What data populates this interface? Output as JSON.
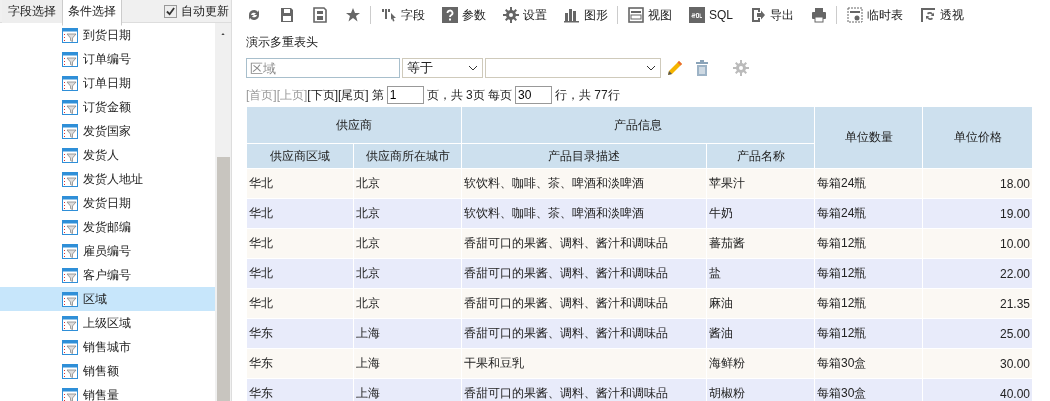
{
  "sidebar": {
    "tabs": [
      {
        "label": "字段选择",
        "selected": false
      },
      {
        "label": "条件选择",
        "selected": true
      }
    ],
    "auto_update": {
      "label": "自动更新",
      "checked": true
    },
    "items": [
      {
        "label": "到货日期",
        "selected": false
      },
      {
        "label": "订单编号",
        "selected": false
      },
      {
        "label": "订单日期",
        "selected": false
      },
      {
        "label": "订货金额",
        "selected": false
      },
      {
        "label": "发货国家",
        "selected": false
      },
      {
        "label": "发货人",
        "selected": false
      },
      {
        "label": "发货人地址",
        "selected": false
      },
      {
        "label": "发货日期",
        "selected": false
      },
      {
        "label": "发货邮编",
        "selected": false
      },
      {
        "label": "雇员编号",
        "selected": false
      },
      {
        "label": "客户编号",
        "selected": false
      },
      {
        "label": "区域",
        "selected": true
      },
      {
        "label": "上级区域",
        "selected": false
      },
      {
        "label": "销售城市",
        "selected": false
      },
      {
        "label": "销售额",
        "selected": false
      },
      {
        "label": "销售量",
        "selected": false
      }
    ]
  },
  "toolbar": [
    [
      {
        "kind": "refresh"
      },
      {
        "kind": "save"
      },
      {
        "kind": "save-as"
      },
      {
        "kind": "star"
      }
    ],
    [
      {
        "kind": "fields",
        "label": "字段"
      },
      {
        "kind": "help",
        "label": "参数"
      },
      {
        "kind": "gear",
        "label": "设置"
      },
      {
        "kind": "chart",
        "label": "图形"
      }
    ],
    [
      {
        "kind": "view",
        "label": "视图"
      },
      {
        "kind": "sql",
        "label": "SQL"
      },
      {
        "kind": "export",
        "label": "导出"
      },
      {
        "kind": "print"
      }
    ],
    [
      {
        "kind": "temp",
        "label": "临时表"
      },
      {
        "kind": "pivot",
        "label": "透视"
      }
    ]
  ],
  "report_title": "演示多重表头",
  "filter": {
    "field": {
      "placeholder": "区域"
    },
    "operator": {
      "value": "等于"
    }
  },
  "pager": {
    "links": [
      {
        "label": "[首页]",
        "disabled": true
      },
      {
        "label": "[上页]",
        "disabled": true
      },
      {
        "label": "[下页]",
        "disabled": false
      },
      {
        "label": "[尾页]",
        "disabled": false
      }
    ],
    "page_prefix": "第",
    "page": "1",
    "page_suffix": "页，共 3页 每页",
    "per_page": "30",
    "total": "行，共 77行"
  },
  "table": {
    "column_groups": [
      {
        "label": "供应商",
        "columns": [
          {
            "label": "供应商区域",
            "kind": "text"
          },
          {
            "label": "供应商所在城市",
            "kind": "text"
          }
        ]
      },
      {
        "label": "产品信息",
        "columns": [
          {
            "label": "产品目录描述",
            "kind": "text"
          },
          {
            "label": "产品名称",
            "kind": "text"
          }
        ]
      },
      {
        "columns": [
          {
            "label": "单位数量",
            "kind": "text"
          }
        ]
      },
      {
        "columns": [
          {
            "label": "单位价格",
            "kind": "number"
          }
        ]
      }
    ],
    "rows": [
      [
        "华北",
        "北京",
        "软饮料、咖啡、茶、啤酒和淡啤酒",
        "苹果汁",
        "每箱24瓶",
        "18.00"
      ],
      [
        "华北",
        "北京",
        "软饮料、咖啡、茶、啤酒和淡啤酒",
        "牛奶",
        "每箱24瓶",
        "19.00"
      ],
      [
        "华北",
        "北京",
        "香甜可口的果酱、调料、酱汁和调味品",
        "蕃茄酱",
        "每箱12瓶",
        "10.00"
      ],
      [
        "华北",
        "北京",
        "香甜可口的果酱、调料、酱汁和调味品",
        "盐",
        "每箱12瓶",
        "22.00"
      ],
      [
        "华北",
        "北京",
        "香甜可口的果酱、调料、酱汁和调味品",
        "麻油",
        "每箱12瓶",
        "21.35"
      ],
      [
        "华东",
        "上海",
        "香甜可口的果酱、调料、酱汁和调味品",
        "酱油",
        "每箱12瓶",
        "25.00"
      ],
      [
        "华东",
        "上海",
        "干果和豆乳",
        "海鲜粉",
        "每箱30盒",
        "30.00"
      ],
      [
        "华东",
        "上海",
        "香甜可口的果酱、调料、酱汁和调味品",
        "胡椒粉",
        "每箱30盒",
        "40.00"
      ]
    ]
  }
}
